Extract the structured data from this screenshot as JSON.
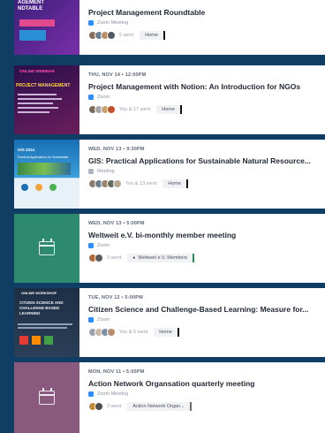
{
  "colors": {
    "background": "#0f3d63",
    "card": "#ffffff",
    "zoom_blue": "#2d8cff"
  },
  "events": [
    {
      "date": "",
      "title": "Project Management Roundtable",
      "location": "Zoom Meeting",
      "location_icon": "zoom-icon",
      "went": "5 went",
      "group": "Home",
      "thumb": {
        "type": "image",
        "title": "AGEMENT\nNDTABLE",
        "colors": [
          "#3b1f7a",
          "#7a2fa8"
        ]
      }
    },
    {
      "date": "THU, NOV 14 • 12:00PM",
      "title": "Project Management with Notion: An Introduction for NGOs",
      "location": "Zoom",
      "location_icon": "zoom-icon",
      "went": "You & 17 went",
      "group": "Home",
      "thumb": {
        "type": "image",
        "title": "ONLINE WEBINAR\nPROJECT MANAGEMENT",
        "colors": [
          "#2a0f4a",
          "#6b1e5c"
        ]
      }
    },
    {
      "date": "WED, NOV 13 • 9:30PM",
      "title": "GIS: Practical Applications for Sustainable Natural Resource...",
      "location": "Meeting",
      "location_icon": "people-icon",
      "went": "You & 13 went",
      "group": "Home",
      "thumb": {
        "type": "image",
        "title": "GIS 2024",
        "colors": [
          "#1a6fb5",
          "#3aa0d9"
        ]
      }
    },
    {
      "date": "WED, NOV 13 • 5:00PM",
      "title": "Weltweit e.V. bi-monthly member meeting",
      "location": "Zoom",
      "location_icon": "zoom-icon",
      "went": "3 went",
      "group": "Weltweit e.V. Members",
      "thumb": {
        "type": "calendar",
        "colors": [
          "#2d8a6e",
          "#2d8a6e"
        ]
      }
    },
    {
      "date": "TUE, NOV 12 • 5:00PM",
      "title": "Citizen Science and Challenge-Based Learning: Measure for...",
      "location": "Zoom",
      "location_icon": "zoom-icon",
      "went": "You & 5 went",
      "group": "Home",
      "thumb": {
        "type": "image",
        "title": "ONLINE WORKSHOP\nCITIZEN SCIENCE AND\nCHALLENGE-BASED LEARNING",
        "colors": [
          "#1d2f45",
          "#2b3f58"
        ]
      }
    },
    {
      "date": "MON, NOV 11 • 5:00PM",
      "title": "Action Network Organsation quarterly meeting",
      "location": "Zoom Meeting",
      "location_icon": "zoom-icon",
      "went": "3 went",
      "group": "Action Network Organ...",
      "thumb": {
        "type": "calendar",
        "colors": [
          "#8a5a7e",
          "#8a5a7e"
        ]
      }
    }
  ]
}
